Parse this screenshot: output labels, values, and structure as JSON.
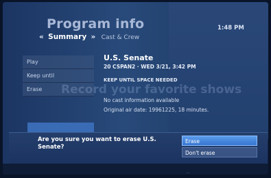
{
  "header": {
    "title": "Program info",
    "clock": "1:48 PM",
    "tab_prev_arrow": "«",
    "tab_active": "Summary",
    "tab_next_arrow": "»",
    "tab_next": "Cast & Crew"
  },
  "menu": {
    "items": [
      {
        "label": "Play"
      },
      {
        "label": "Keep until"
      },
      {
        "label": "Erase"
      }
    ]
  },
  "program": {
    "title": "U.S. Senate",
    "channel_line": "20 CSPAN2 · WED 3/21, 3:42 PM",
    "keep_status": "KEEP UNTIL SPACE NEEDED",
    "cast_info": "No cast information available",
    "original_air_date": "Original air date: 19961225, 18 minutes."
  },
  "watermark": "Record your favorite shows",
  "dialog": {
    "question": "Are you sure you want to erase U.S. Senate?",
    "confirm_label": "Erase",
    "cancel_label": "Don't erase"
  },
  "footer": {
    "text": "..."
  }
}
